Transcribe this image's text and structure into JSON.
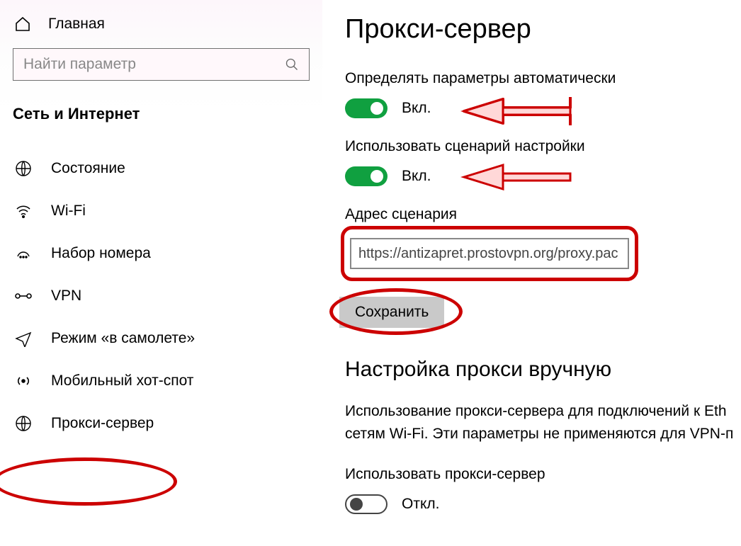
{
  "sidebar": {
    "home_label": "Главная",
    "search_placeholder": "Найти параметр",
    "category": "Сеть и Интернет",
    "items": [
      {
        "label": "Состояние",
        "icon": "globe-icon"
      },
      {
        "label": "Wi-Fi",
        "icon": "wifi-icon"
      },
      {
        "label": "Набор номера",
        "icon": "dialup-icon"
      },
      {
        "label": "VPN",
        "icon": "vpn-icon"
      },
      {
        "label": "Режим «в самолете»",
        "icon": "airplane-icon"
      },
      {
        "label": "Мобильный хот-спот",
        "icon": "hotspot-icon"
      },
      {
        "label": "Прокси-сервер",
        "icon": "proxy-icon"
      }
    ]
  },
  "main": {
    "title": "Прокси-сервер",
    "auto_detect_label": "Определять параметры автоматически",
    "auto_detect_state": "Вкл.",
    "use_script_label": "Использовать сценарий настройки",
    "use_script_state": "Вкл.",
    "script_address_label": "Адрес сценария",
    "script_address_value": "https://antizapret.prostovpn.org/proxy.pac",
    "save_label": "Сохранить",
    "manual_title": "Настройка прокси вручную",
    "manual_desc_line1": "Использование прокси-сервера для подключений к Eth",
    "manual_desc_line2": "сетям Wi-Fi. Эти параметры не применяются для VPN-п",
    "use_proxy_label": "Использовать прокси-сервер",
    "use_proxy_state": "Откл."
  }
}
